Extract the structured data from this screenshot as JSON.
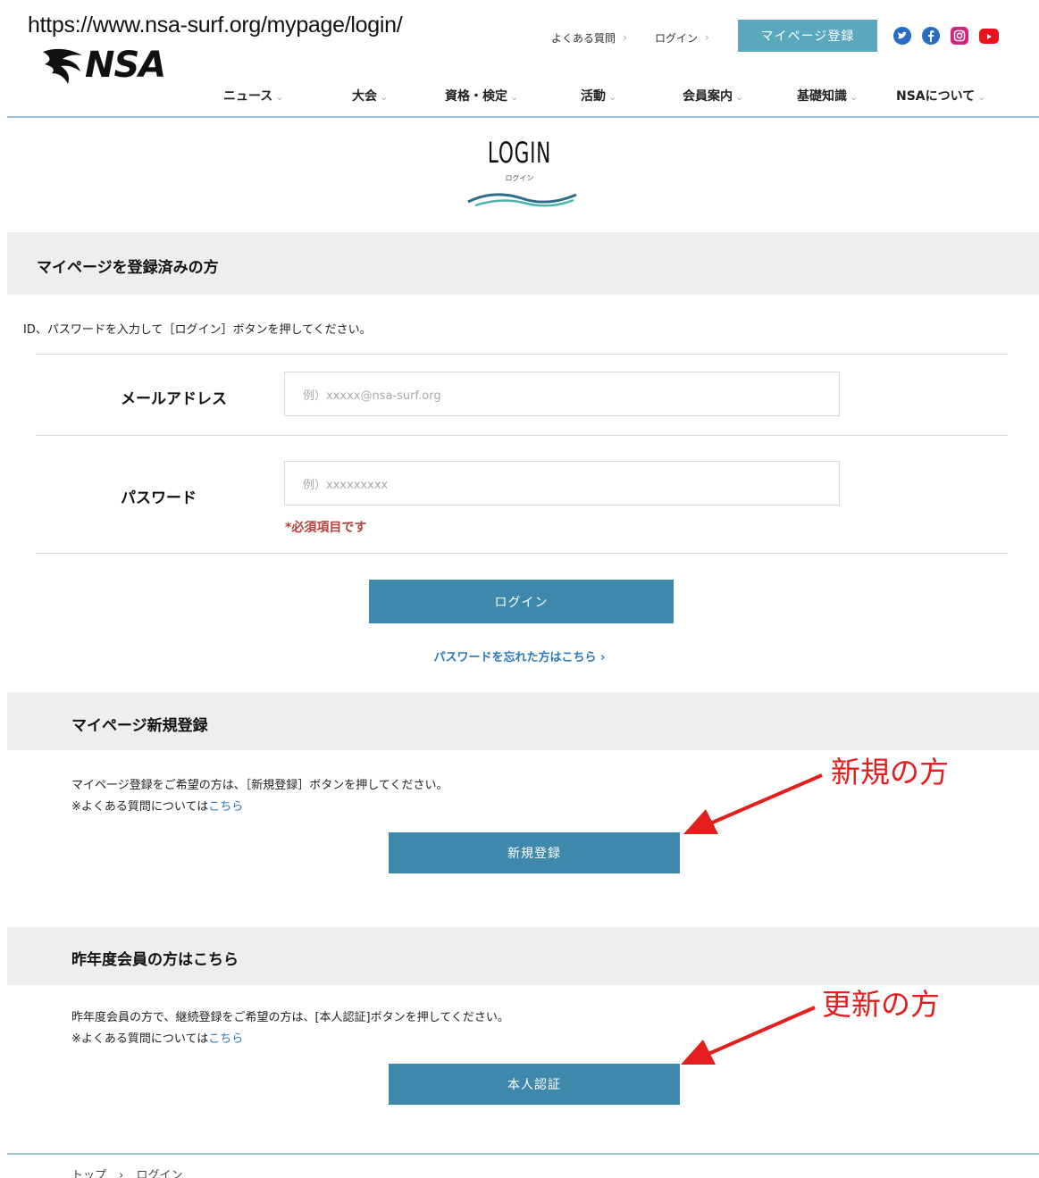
{
  "url": "https://www.nsa-surf.org/mypage/login/",
  "logo": {
    "text": "NSA",
    "small_text": "NSA"
  },
  "topnav": {
    "faq": "よくある質問",
    "login": "ログイン",
    "register_button": "マイページ登録",
    "chevron": "›",
    "social": [
      {
        "name": "twitter",
        "color": "#2a6bc4"
      },
      {
        "name": "facebook",
        "color": "#2a6bc4"
      },
      {
        "name": "instagram",
        "color": "#d0247a"
      },
      {
        "name": "youtube",
        "color": "#e8131d"
      }
    ]
  },
  "mainnav": {
    "items": [
      "ニュース",
      "大会",
      "資格・検定",
      "活動",
      "会員案内",
      "基礎知識",
      "NSAについて"
    ],
    "dropdown_glyph": "⌄"
  },
  "hero": {
    "title": "LOGIN",
    "subtitle": "ログイン"
  },
  "login_section": {
    "heading": "マイページを登録済みの方",
    "instruction": "ID、パスワードを入力して［ログイン］ボタンを押してください。",
    "email_label": "メールアドレス",
    "email_placeholder": "例）xxxxx@nsa-surf.org",
    "password_label": "パスワード",
    "password_placeholder": "例）xxxxxxxxx",
    "required_note": "*必須項目です",
    "login_button": "ログイン",
    "forgot_link": "パスワードを忘れた方はこちら ›"
  },
  "new_section": {
    "heading": "マイページ新規登録",
    "line1": "マイページ登録をご希望の方は、［新規登録］ボタンを押してください。",
    "line2_prefix": "※よくある質問については",
    "line2_link": "こちら",
    "button": "新規登録",
    "annotation": "新規の方"
  },
  "renew_section": {
    "heading": "昨年度会員の方はこちら",
    "line1": "昨年度会員の方で、継続登録をご希望の方は、[本人認証]ボタンを押してください。",
    "line2_prefix": "※よくある質問については",
    "line2_link": "こちら",
    "button": "本人認証",
    "annotation": "更新の方"
  },
  "breadcrumb": {
    "home": "トップ",
    "separator": "›",
    "current": "ログイン"
  },
  "colors": {
    "accent": "#3d88ab",
    "register_button": "#5aa8bd",
    "annotation_red": "#e41d1d",
    "link_blue": "#2c78b8",
    "required_red": "#b5413d"
  }
}
